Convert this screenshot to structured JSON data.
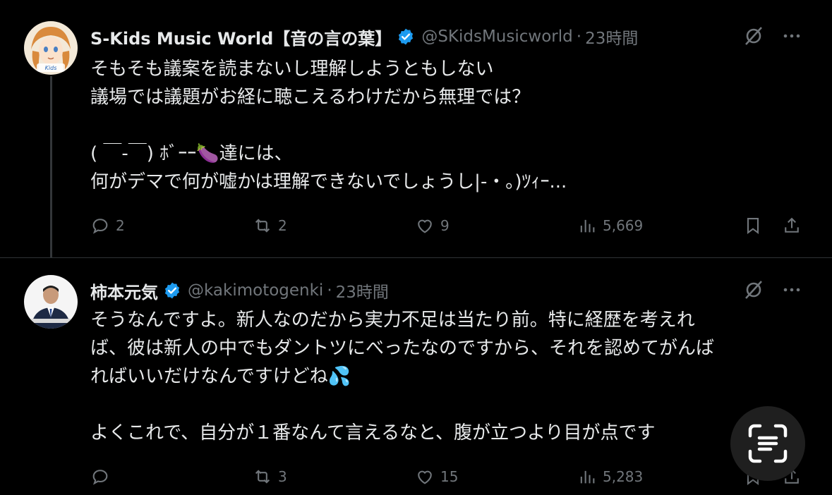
{
  "tweets": [
    {
      "author_name": "S-Kids Music World【音の言の葉】",
      "handle": "@SKidsMusicworld",
      "separator": "·",
      "time": "23時間",
      "text": "そもそも議案を読まないし理解しようともしない\n議場では議題がお経に聴こえるわけだから無理では？\n\n( ￣-￣) ﾎﾞｰｰ🍆達には、\n何がデマで何が嘘かは理解できないでしょうし|-・｡)ﾂｨｰ...",
      "avatar_label": "Kids",
      "stats": {
        "replies": "2",
        "reposts": "2",
        "likes": "9",
        "views": "5,669"
      }
    },
    {
      "author_name": "柿本元気",
      "handle": "@kakimotogenki",
      "separator": "·",
      "time": "23時間",
      "text": "そうなんですよ。新人なのだから実力不足は当たり前。特に経歴を考えれ\nば、彼は新人の中でもダントツにべったなのですから、それを認めてがんば\nればいいだけなんですけどね💦\n\nよくこれで、自分が１番なんて言えるなと、腹が立つより目が点です",
      "stats": {
        "replies": "",
        "reposts": "3",
        "likes": "15",
        "views": "5,283"
      }
    }
  ],
  "icons": {
    "verified": "verified-badge-icon",
    "grok": "grok-icon",
    "more": "more-icon",
    "reply": "reply-icon",
    "repost": "repost-icon",
    "like": "like-icon",
    "views": "views-icon",
    "bookmark": "bookmark-icon",
    "share": "share-icon",
    "lens": "google-lens-icon"
  },
  "colors": {
    "background": "#000000",
    "text": "#e7e9ea",
    "secondary": "#71767b",
    "verified": "#1d9bf0",
    "divider": "#2f3336"
  }
}
